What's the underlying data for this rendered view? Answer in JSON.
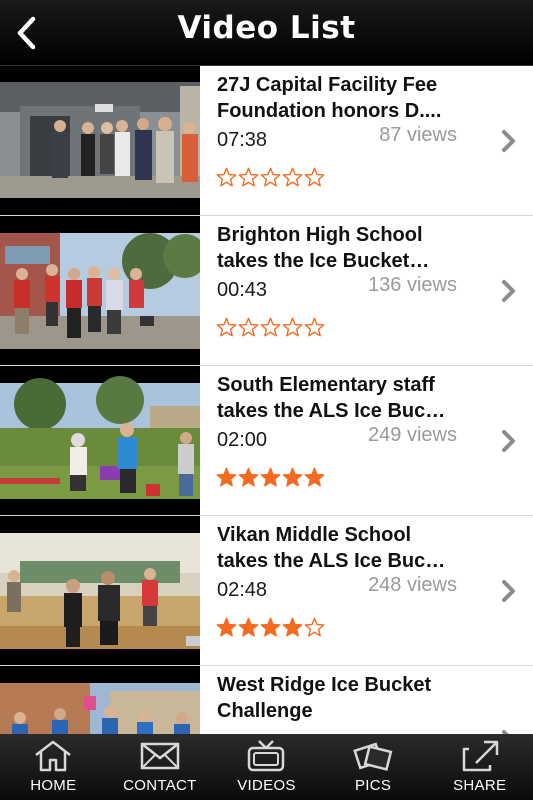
{
  "header": {
    "title": "Video List",
    "back_icon": "chevron-left-icon"
  },
  "videos": [
    {
      "title": "27J Capital Facility Fee\nFoundation honors D....",
      "duration": "07:38",
      "views": "87 views",
      "rating": 0
    },
    {
      "title": "Brighton High School\ntakes the Ice Bucket…",
      "duration": "00:43",
      "views": "136 views",
      "rating": 0
    },
    {
      "title": "South Elementary staff\ntakes the ALS Ice Buc…",
      "duration": "02:00",
      "views": "249 views",
      "rating": 5
    },
    {
      "title": "Vikan Middle School\ntakes the ALS Ice Buc…",
      "duration": "02:48",
      "views": "248 views",
      "rating": 4
    },
    {
      "title": "West Ridge Ice Bucket\nChallenge",
      "duration": "",
      "views": "",
      "rating": 0
    }
  ],
  "colors": {
    "star": "#f36b21",
    "header_bg": "#000000",
    "tab_bg": "#1c1c1c"
  },
  "tabs": [
    {
      "label": "HOME",
      "icon": "home-icon"
    },
    {
      "label": "CONTACT",
      "icon": "envelope-icon"
    },
    {
      "label": "VIDEOS",
      "icon": "tv-icon"
    },
    {
      "label": "PICS",
      "icon": "photos-icon"
    },
    {
      "label": "SHARE",
      "icon": "share-icon"
    }
  ]
}
